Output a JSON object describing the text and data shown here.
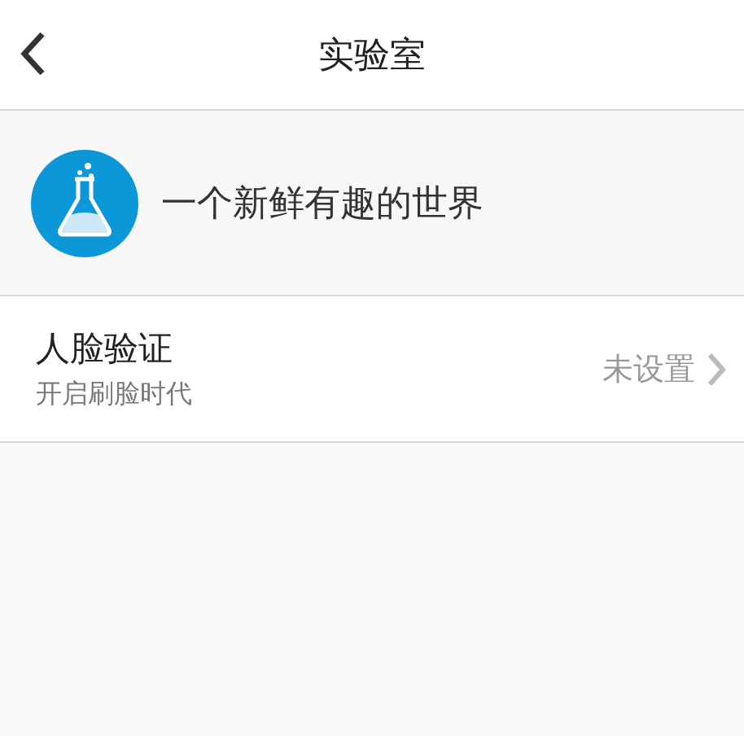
{
  "header": {
    "title": "实验室"
  },
  "banner": {
    "text": "一个新鲜有趣的世界"
  },
  "settings": [
    {
      "title": "人脸验证",
      "subtitle": "开启刷脸时代",
      "value": "未设置"
    }
  ]
}
